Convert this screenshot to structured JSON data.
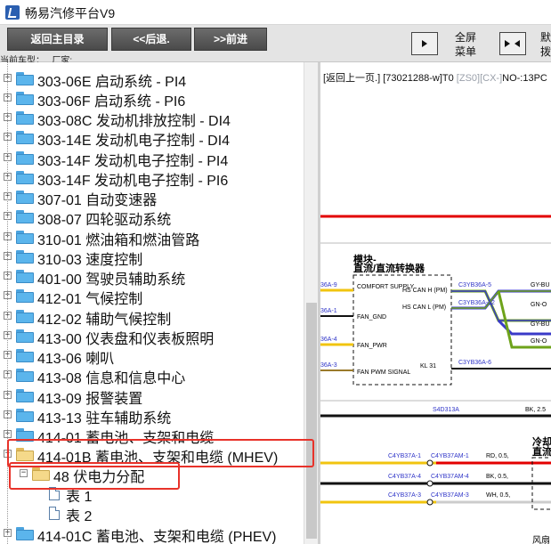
{
  "window": {
    "title": "畅易汽修平台V9"
  },
  "toolbar": {
    "home_label": "返回主目录",
    "back_label": "<<后退.",
    "forward_label": ">>前进",
    "car_label": "当前车型：   厂家:",
    "fullscreen_label": "全屏\n菜单",
    "other_label": "默\n拨"
  },
  "tree": {
    "items": [
      {
        "label": "303-06E 启动系统 - PI4"
      },
      {
        "label": "303-06F 启动系统 - PI6"
      },
      {
        "label": "303-08C 发动机排放控制 - DI4"
      },
      {
        "label": "303-14E 发动机电子控制 - DI4"
      },
      {
        "label": "303-14F 发动机电子控制 - PI4"
      },
      {
        "label": "303-14F 发动机电子控制 - PI6"
      },
      {
        "label": "307-01 自动变速器"
      },
      {
        "label": "308-07 四轮驱动系统"
      },
      {
        "label": "310-01 燃油箱和燃油管路"
      },
      {
        "label": "310-03 速度控制"
      },
      {
        "label": "401-00 驾驶员辅助系统"
      },
      {
        "label": "412-01 气候控制"
      },
      {
        "label": "412-02 辅助气候控制"
      },
      {
        "label": "413-00 仪表盘和仪表板照明"
      },
      {
        "label": "413-06 喇叭"
      },
      {
        "label": "413-08 信息和信息中心"
      },
      {
        "label": "413-09 报警装置"
      },
      {
        "label": "413-13 驻车辅助系统"
      },
      {
        "label": "414-01 蓄电池、支架和电缆"
      },
      {
        "label": "414-01B 蓄电池、支架和电缆 (MHEV)"
      },
      {
        "label": "48 伏电力分配"
      },
      {
        "label": "表 1"
      },
      {
        "label": "表 2"
      },
      {
        "label": "414-01C 蓄电池、支架和电缆 (PHEV)"
      }
    ]
  },
  "diagram": {
    "nav_back": "[返回上一页.]",
    "nav_id": "[73021288-w]T0",
    "nav_zs": "[ZS0][CX-]",
    "nav_no": "NO-:13PC",
    "module_title_1": "模块-",
    "module_title_2": "直流/直流转换器",
    "pins": [
      "COMFORT SUPPLY",
      "HS CAN H (PM)",
      "HS CAN L (PM)",
      "FAN_GND",
      "FAN_PWR",
      "FAN PWM SIGNAL",
      "KL 31"
    ],
    "left_wires": [
      "36A-9",
      "36A-1",
      "36A-4",
      "36A-3"
    ],
    "right_wires": [
      "C3YB36A-5",
      "C3YB36A-12",
      "C3YB36A-6"
    ],
    "right_colors": [
      "GY-BU",
      "GN-O",
      "GY-BU",
      "GN-O"
    ],
    "ground": "S4D313A",
    "ground_spec": "BK, 2.5",
    "lower_wires": [
      {
        "from": "C4YB37A-1",
        "to": "C4YB37AM-1",
        "spec": "RD, 0.5,"
      },
      {
        "from": "C4YB37A-4",
        "to": "C4YB37AM-4",
        "spec": "BK, 0.5,"
      },
      {
        "from": "C4YB37A-3",
        "to": "C4YB37AM-3",
        "spec": "WH, 0.5,"
      }
    ],
    "right_title_1": "冷却",
    "right_title_2": "直流",
    "bottom_note": "风扇"
  }
}
